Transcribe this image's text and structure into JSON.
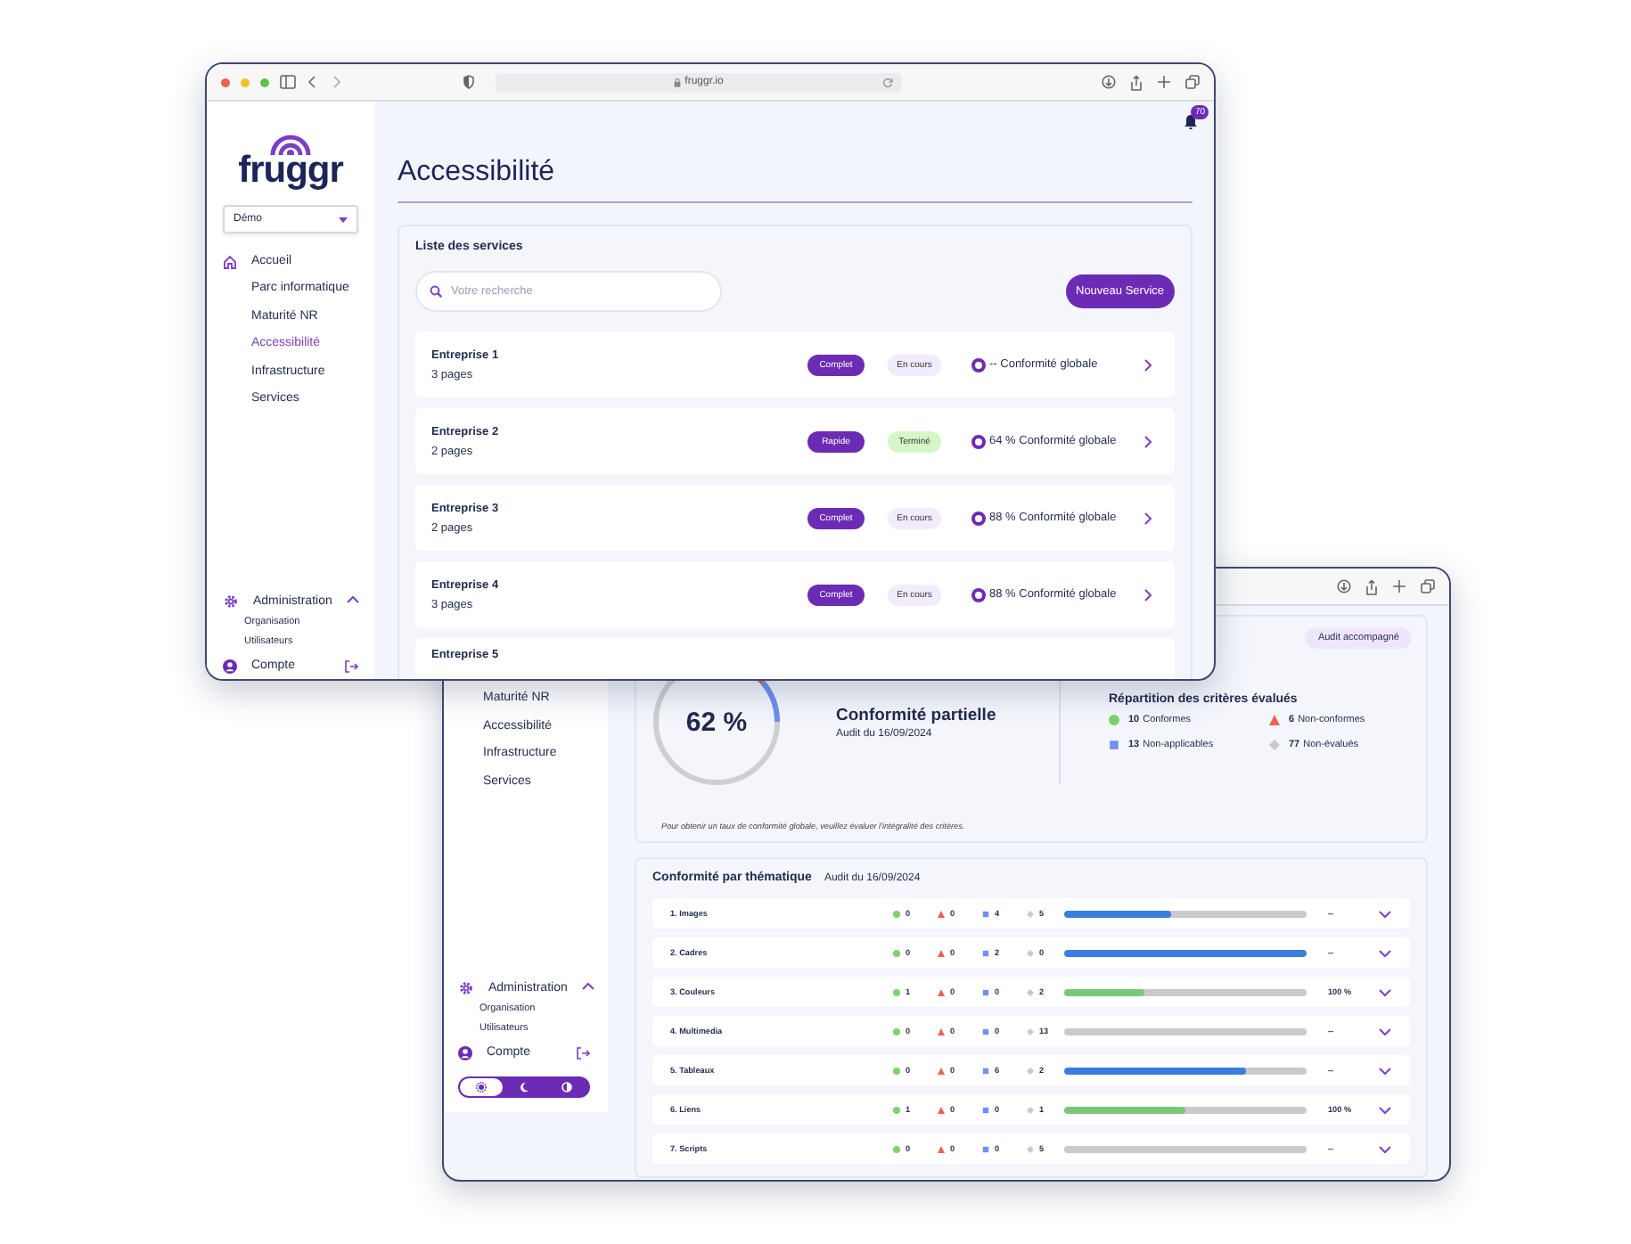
{
  "back_window": {
    "sidebar": {
      "nav": [
        {
          "label": "Maturité NR",
          "selected": false
        },
        {
          "label": "Accessibilité",
          "selected": false
        },
        {
          "label": "Infrastructure",
          "selected": false
        },
        {
          "label": "Services",
          "selected": false
        }
      ],
      "admin": {
        "label": "Administration",
        "expanded": true,
        "children": [
          "Organisation",
          "Utilisateurs"
        ]
      },
      "account": {
        "label": "Compte"
      },
      "themes": [
        {
          "kind": "light",
          "selected": true
        },
        {
          "kind": "dark",
          "selected": false
        },
        {
          "kind": "contrast",
          "selected": false
        }
      ]
    },
    "summary": {
      "badge": "Audit accompagné",
      "score": "62 %",
      "title": "Conformité partielle",
      "date": "Audit du 16/09/2024",
      "legend_title": "Répartition des critères évalués",
      "legend": [
        {
          "count": "10",
          "label": "Conformes",
          "kind": "circle",
          "color": "#7ed36a"
        },
        {
          "count": "6",
          "label": "Non-conformes",
          "kind": "triangle",
          "color": "#e8644c"
        },
        {
          "count": "13",
          "label": "Non-applicables",
          "kind": "square",
          "color": "#6f8ff2"
        },
        {
          "count": "77",
          "label": "Non-évalués",
          "kind": "diamond",
          "color": "#c9c9c9"
        }
      ],
      "note": "Pour obtenir un taux de conformité globale, veuillez évaluer l'intégralité des critères."
    },
    "themes": {
      "title": "Conformité par thématique",
      "date": "Audit du 16/09/2024",
      "rows": [
        {
          "name": "1. Images",
          "counts": [
            "0",
            "0",
            "4",
            "5"
          ],
          "level": 0.44,
          "color": "#3a7de0",
          "value": "--"
        },
        {
          "name": "2. Cadres",
          "counts": [
            "0",
            "0",
            "2",
            "0"
          ],
          "level": 1,
          "color": "#3a7de0",
          "value": "--"
        },
        {
          "name": "3. Couleurs",
          "counts": [
            "1",
            "0",
            "0",
            "2"
          ],
          "level": 0.33,
          "color": "#79c878",
          "value": "100 %"
        },
        {
          "name": "4. Multimedia",
          "counts": [
            "0",
            "0",
            "0",
            "13"
          ],
          "value": "--"
        },
        {
          "name": "5. Tableaux",
          "counts": [
            "0",
            "0",
            "6",
            "2"
          ],
          "level": 0.75,
          "color": "#3a7de0",
          "value": "--"
        },
        {
          "name": "6. Liens",
          "counts": [
            "1",
            "0",
            "0",
            "1"
          ],
          "level": 0.5,
          "color": "#79c878",
          "value": "100 %"
        },
        {
          "name": "7. Scripts",
          "counts": [
            "0",
            "0",
            "0",
            "5"
          ],
          "value": "--"
        }
      ]
    }
  },
  "front_window": {
    "url": "fruggr.io",
    "sidebar": {
      "logo": "fruggr",
      "org_select": {
        "value": "Démo"
      },
      "nav": {
        "label": "Accueil",
        "selected": false,
        "children": [
          {
            "label": "Parc informatique",
            "selected": false
          },
          {
            "label": "Maturité NR",
            "selected": false
          },
          {
            "label": "Accessibilité",
            "selected": true
          },
          {
            "label": "Infrastructure",
            "selected": false
          },
          {
            "label": "Services",
            "selected": false
          }
        ]
      },
      "admin": {
        "label": "Administration",
        "expanded": true,
        "children": [
          "Organisation",
          "Utilisateurs"
        ]
      },
      "account": {
        "label": "Compte"
      }
    },
    "notifications": {
      "count": "70"
    },
    "page_title": "Accessibilité",
    "services": {
      "title": "Liste des services",
      "search": {
        "placeholder": "Votre recherche"
      },
      "new_button": "Nouveau Service",
      "rows": [
        {
          "name": "Entreprise 1",
          "pages": "3 pages",
          "type": "Complet",
          "status": "En cours",
          "done": false,
          "score": "-- Conformité globale"
        },
        {
          "name": "Entreprise 2",
          "pages": "2 pages",
          "type": "Rapide",
          "status": "Terminé",
          "done": true,
          "score": "64 % Conformité globale"
        },
        {
          "name": "Entreprise 3",
          "pages": "2 pages",
          "type": "Complet",
          "status": "En cours",
          "done": false,
          "score": "88 % Conformité globale"
        },
        {
          "name": "Entreprise 4",
          "pages": "3 pages",
          "type": "Complet",
          "status": "En cours",
          "done": false,
          "score": "88 % Conformité globale"
        },
        {
          "name": "Entreprise 5"
        }
      ]
    }
  }
}
